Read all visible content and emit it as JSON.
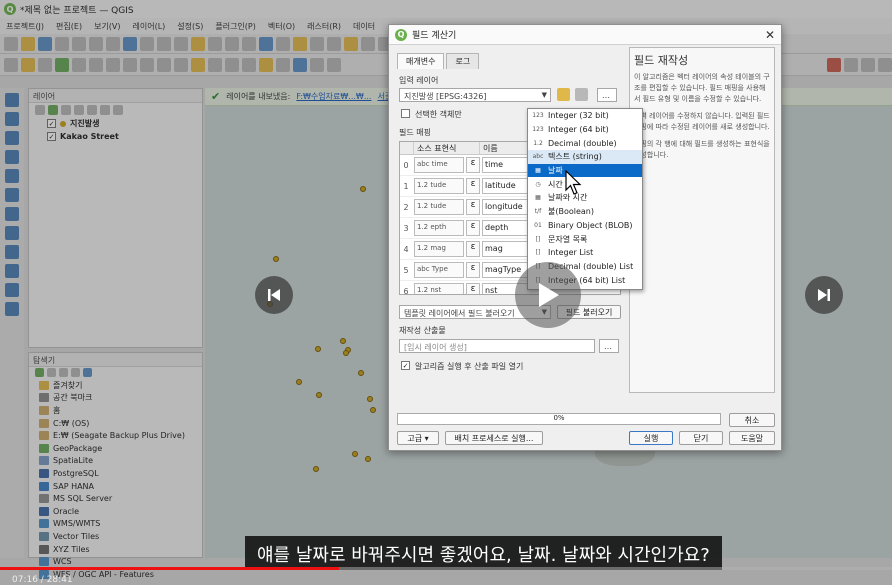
{
  "window": {
    "title": "*제목 없는 프로젝트 — QGIS"
  },
  "menu": [
    "프로젝트(J)",
    "편집(E)",
    "보기(V)",
    "레이어(L)",
    "설정(S)",
    "플러그인(P)",
    "벡터(O)",
    "래스터(R)",
    "데이터"
  ],
  "layers_panel": {
    "title": "레이어",
    "layers": [
      {
        "name": "지진발생",
        "checked": true
      },
      {
        "name": "Kakao Street",
        "checked": true
      }
    ]
  },
  "browser_panel": {
    "title": "탐색기",
    "items": [
      "즐겨찾기",
      "공간 북마크",
      "홈",
      "C:₩ (OS)",
      "E:₩ (Seagate Backup Plus Drive)",
      "GeoPackage",
      "SpatiaLite",
      "PostgreSQL",
      "SAP HANA",
      "MS SQL Server",
      "Oracle",
      "WMS/WMTS",
      "Vector Tiles",
      "XYZ Tiles",
      "WCS",
      "WFS / OGC API - Features"
    ]
  },
  "message_bar": {
    "text": "레이어를 내보냈음:",
    "link": "F:₩수업자료₩...₩...",
    "link2": "서길"
  },
  "dialog": {
    "title": "필드 계산기",
    "close": "✕",
    "tabs": [
      "매개변수",
      "로그"
    ],
    "input_layer_label": "입력 레이어",
    "input_layer_value": "지진발생 [EPSG:4326]",
    "selected_only_label": "선택한 객체만",
    "field_mapping_label": "필드 매핑",
    "table_headers": [
      "소스 표현식",
      "이름"
    ],
    "rows": [
      {
        "index": "0",
        "source": "abc time",
        "name": "time"
      },
      {
        "index": "1",
        "source": "1.2 tude",
        "name": "latitude"
      },
      {
        "index": "2",
        "source": "1.2 tude",
        "name": "longitude"
      },
      {
        "index": "3",
        "source": "1.2 epth",
        "name": "depth"
      },
      {
        "index": "4",
        "source": "1.2 mag",
        "name": "mag"
      },
      {
        "index": "5",
        "source": "abc Type",
        "name": "magType"
      },
      {
        "index": "6",
        "source": "1.2 nst",
        "name": "nst"
      }
    ],
    "load_fields_label": "템플릿 레이어에서 필드 불러오기",
    "load_fields_button": "필드 불러오기",
    "output_label": "재작성 산출물",
    "output_placeholder": "[임시 레이어 생성]",
    "open_after_label": "알고리즘 실행 후 산출 파일 열기",
    "progress": "0%",
    "cancel_button": "취소",
    "advanced_button": "고급 ▾",
    "batch_button": "배치 프로세스로 실행...",
    "run_button": "실행",
    "close_button": "닫기",
    "help_button": "도움말",
    "help_title": "필드 재작성",
    "help_paragraphs": [
      "이 알고리즘은 벡터 레이어의 속성 테이블의 구조를 편집할 수 있습니다. 필드 매핑을 사용해서 필드 유형 및 이름을 수정할 수 있습니다.",
      "입력 레이어를 수정하지 않습니다. 입력된 필드 매핑에 따라 수정된 레이어를 새로 생성합니다.",
      "매핑의 각 행에 대해 필드를 생성하는 표현식을 작성합니다."
    ]
  },
  "type_menu": {
    "items": [
      {
        "icon": "123",
        "label": "Integer (32 bit)"
      },
      {
        "icon": "123",
        "label": "Integer (64 bit)"
      },
      {
        "icon": "1.2",
        "label": "Decimal (double)"
      },
      {
        "icon": "abc",
        "label": "텍스트 (string)"
      },
      {
        "icon": "▦",
        "label": "날짜"
      },
      {
        "icon": "◷",
        "label": "시간"
      },
      {
        "icon": "▦",
        "label": "날짜와 시간"
      },
      {
        "icon": "t/f",
        "label": "불(Boolean)"
      },
      {
        "icon": "01",
        "label": "Binary Object (BLOB)"
      },
      {
        "icon": "[]",
        "label": "문자열 목록"
      },
      {
        "icon": "[]",
        "label": "Integer List"
      },
      {
        "icon": "[]",
        "label": "Decimal (double) List"
      },
      {
        "icon": "[]",
        "label": "Integer (64 bit) List"
      }
    ],
    "selected_index": 4
  },
  "player": {
    "subtitle": "얘를 날짜로 바꿔주시면 좋겠어요, 날짜. 날짜와 시간인가요?",
    "timestamp": "07:16 / 28:41",
    "progress": 0.38
  }
}
